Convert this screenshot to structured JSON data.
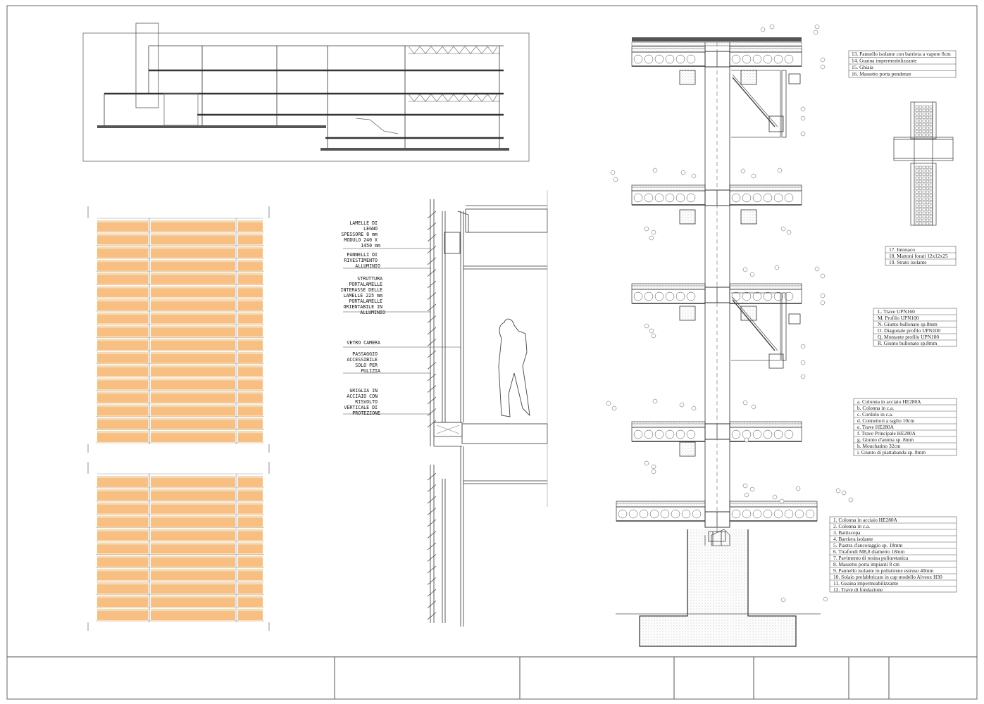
{
  "labels": {
    "lamelle": [
      "LAMELLE DI",
      "LEGNO",
      "SPESSORE 8 mm",
      "MODULO 240 X",
      "1450 mm"
    ],
    "pannelli": [
      "PANNELLI DI",
      "RIVESTIMENTO",
      "ALLUMINIO"
    ],
    "struttura": [
      "STRUTTURA",
      "PORTALAMELLE",
      "INTERASSE DELLE",
      "LAMELLE 225 mm",
      "PORTALAMELLE",
      "ORIENTABILE IN",
      "ALLUMINIO"
    ],
    "vetro": [
      "VETRO CAMERA"
    ],
    "passaggio": [
      "PASSAGGIO",
      "ACCESSIBILE",
      "SOLO PER",
      "PULIZIA"
    ],
    "griglia": [
      "GRIGLIA IN",
      "ACCIAIO CON",
      "RISVOLTO",
      "VERTICALE DI",
      "PROTEZIONE"
    ]
  },
  "legends": {
    "roof": [
      "13.  Pannello isolante con barriera a vapore 8cm",
      "14.  Guaina impermeabilizzante",
      "15.  Ghiaia",
      "16.  Massetto porta pendenze"
    ],
    "wall": [
      "17.  Intonaco",
      "18.  Mattoni forati 12x12x25",
      "19.  Strato isolante"
    ],
    "profiles": [
      "L.  Trave UPN160",
      "M.  Profilo UPN100",
      "N.  Giunto bullonato sp.8mm",
      "O.  Diagonale profilo UPN100",
      "Q.  Montante profilo UPN100",
      "R.  Giunto bullonato sp.8mm"
    ],
    "steel": [
      "a.  Colonna in acciaio HE280A",
      "b.  Colonna in c.a.",
      "c.  Cordolo in c.a.",
      "d.  Connettori a taglio 10cm",
      "e.  Trave HE280A",
      "f.  Trave Principale HE280A",
      "g.  Giunto d'anima sp. 8mm",
      "h.  Mouchatino 32cm",
      "i.  Giunto di piattabanda sp. 8mm"
    ],
    "foundation": [
      "1.  Colonna in acciaio HE280A",
      "2.  Colonna in c.a.",
      "3.  Battiscopa",
      "4.  Barriera isolante",
      "5.  Piastra d'ancoraggio sp. 18mm",
      "6.  Tirafondi M8,8 diametro 18mm",
      "7.  Pavimento di resina poliuretanica",
      "8.  Massetto porta impianti 8 cm",
      "9.  Pannello isolante in polistirene estruso 40mm",
      "10.  Solaio prefabbricato in cap modello Alveox H30",
      "11.  Guaina impermeabilizzante",
      "12.  Trave di fondazione"
    ]
  },
  "colors": {
    "lamella": "#f8bf80",
    "lamella_light": "#fdd8a8",
    "line": "#333333"
  }
}
